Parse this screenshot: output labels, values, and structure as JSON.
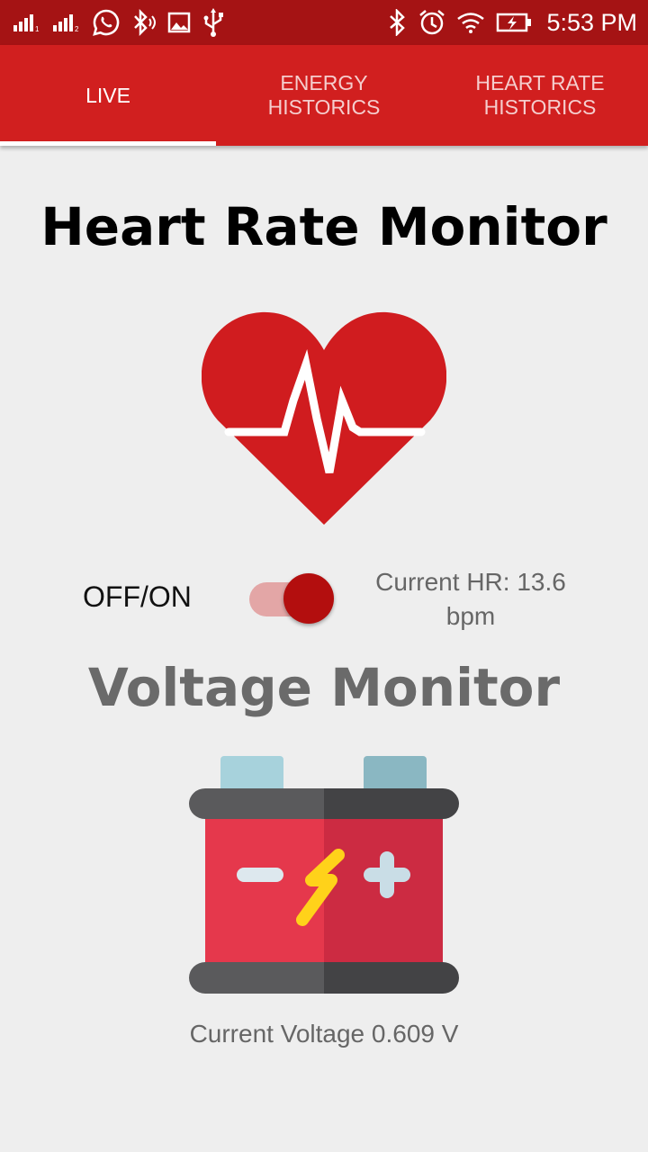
{
  "status_bar": {
    "time": "5:53 PM",
    "left_icons": [
      "signal-1-icon",
      "signal-2-icon",
      "whatsapp-icon",
      "bluetooth-audio-icon",
      "image-icon",
      "usb-icon"
    ],
    "right_icons": [
      "bluetooth-icon",
      "alarm-icon",
      "wifi-icon",
      "battery-charging-icon"
    ],
    "background": "#a51314"
  },
  "tabs": [
    {
      "label": "LIVE",
      "selected": true
    },
    {
      "label": "ENERGY\nHISTORICS",
      "selected": false
    },
    {
      "label": "HEART RATE\nHISTORICS",
      "selected": false
    }
  ],
  "heart_section": {
    "title": "Heart Rate Monitor",
    "icon": "heart-pulse-icon",
    "toggle_label": "OFF/ON",
    "toggle_on": true,
    "current_hr": "Current HR: 13.6 bpm"
  },
  "voltage_section": {
    "title": "Voltage Monitor",
    "icon": "car-battery-icon",
    "current_voltage": "Current Voltage 0.609 V"
  },
  "colors": {
    "accent": "#d11f1f",
    "heart": "#d01c1f",
    "toggle_thumb": "#b30e0e",
    "toggle_track": "#e3a6a6",
    "background": "#eeeeee"
  }
}
